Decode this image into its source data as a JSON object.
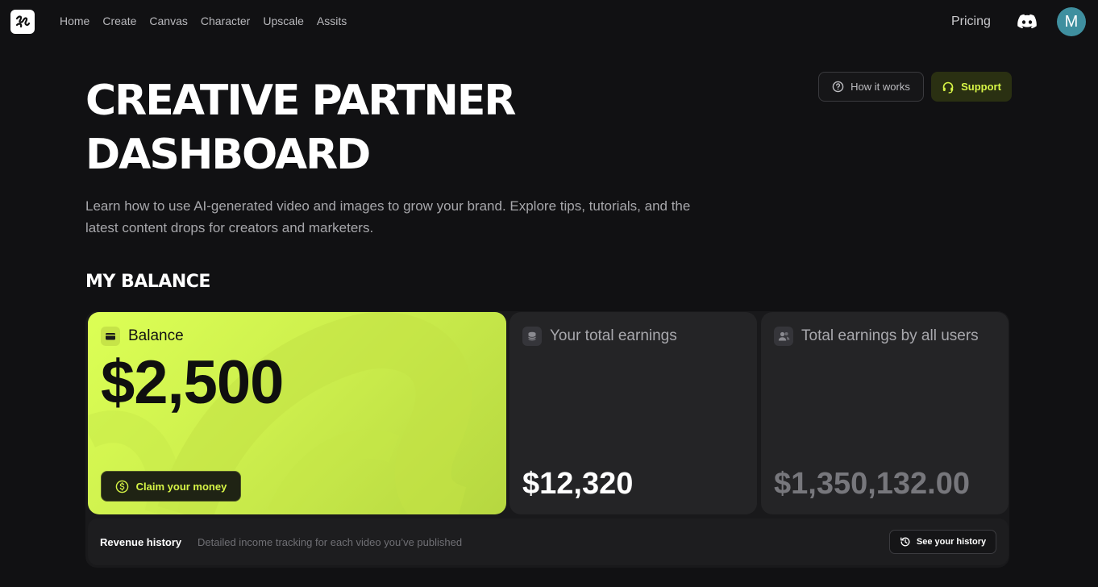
{
  "nav": {
    "links": [
      "Home",
      "Create",
      "Canvas",
      "Character",
      "Upscale",
      "Assits"
    ],
    "pricing": "Pricing",
    "avatar_initial": "M"
  },
  "header": {
    "title_line1": "CREATIVE PARTNER",
    "title_line2": "DASHBOARD",
    "description": "Learn how to use AI-generated video and images to grow your brand. Explore tips, tutorials, and the latest content drops for creators and marketers.",
    "how_it_works_label": "How it works",
    "support_label": "Support"
  },
  "balance_section": {
    "title": "MY BALANCE",
    "balance": {
      "label": "Balance",
      "amount": "$2,500",
      "claim_label": "Claim your money"
    },
    "your_earnings": {
      "label": "Your total earnings",
      "amount": "$12,320"
    },
    "all_users_earnings": {
      "label": "Total earnings by all users",
      "amount": "$1,350,132.00"
    }
  },
  "revenue": {
    "title": "Revenue history",
    "description": "Detailed income tracking for each video you’ve published",
    "button_label": "See your history"
  },
  "colors": {
    "background": "#111113",
    "accent": "#d7f546",
    "card_dark": "#242426"
  }
}
